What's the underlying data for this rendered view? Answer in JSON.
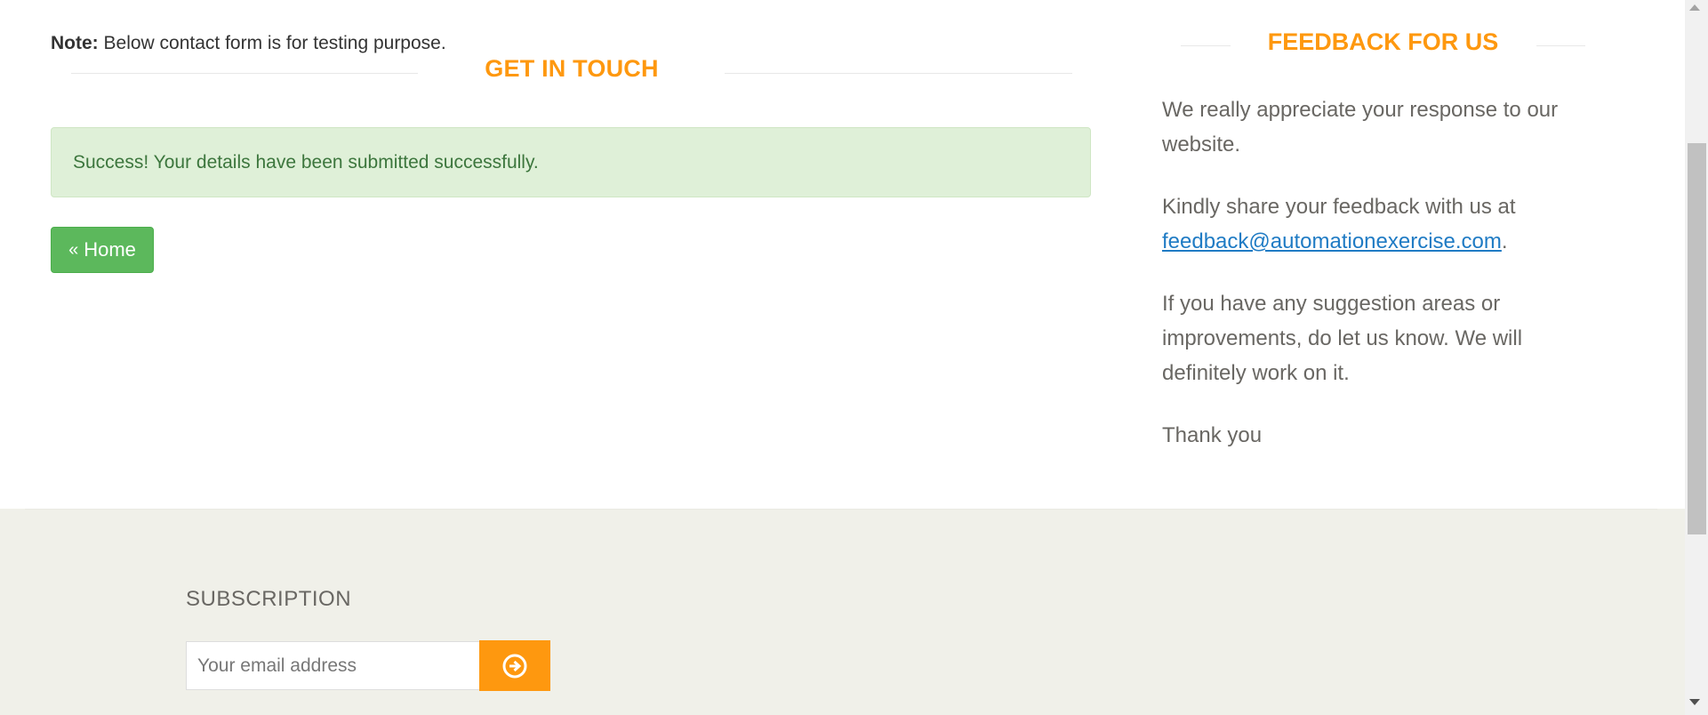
{
  "note": {
    "label": "Note:",
    "text": " Below contact form is for testing purpose."
  },
  "contact": {
    "title": "GET IN TOUCH",
    "success_message": "Success! Your details have been submitted successfully.",
    "home_button": "Home",
    "home_icon": "double-chevron-left-icon"
  },
  "feedback": {
    "title": "FEEDBACK FOR US",
    "p1": "We really appreciate your response to our website.",
    "p2_before": "Kindly share your feedback with us at ",
    "email": "feedback@automationexercise.com",
    "p2_after": ".",
    "p3": "If you have any suggestion areas or improvements, do let us know. We will definitely work on it.",
    "p4": "Thank you"
  },
  "footer": {
    "subscription_title": "SUBSCRIPTION",
    "email_placeholder": "Your email address",
    "subscribe_icon": "arrow-circle-right-icon"
  },
  "colors": {
    "accent": "#fe980f",
    "success_bg": "#dff0d8",
    "success_text": "#3c763d",
    "button_green": "#5cb85c",
    "footer_bg": "#f0f0e9",
    "link": "#1f7bc4"
  }
}
